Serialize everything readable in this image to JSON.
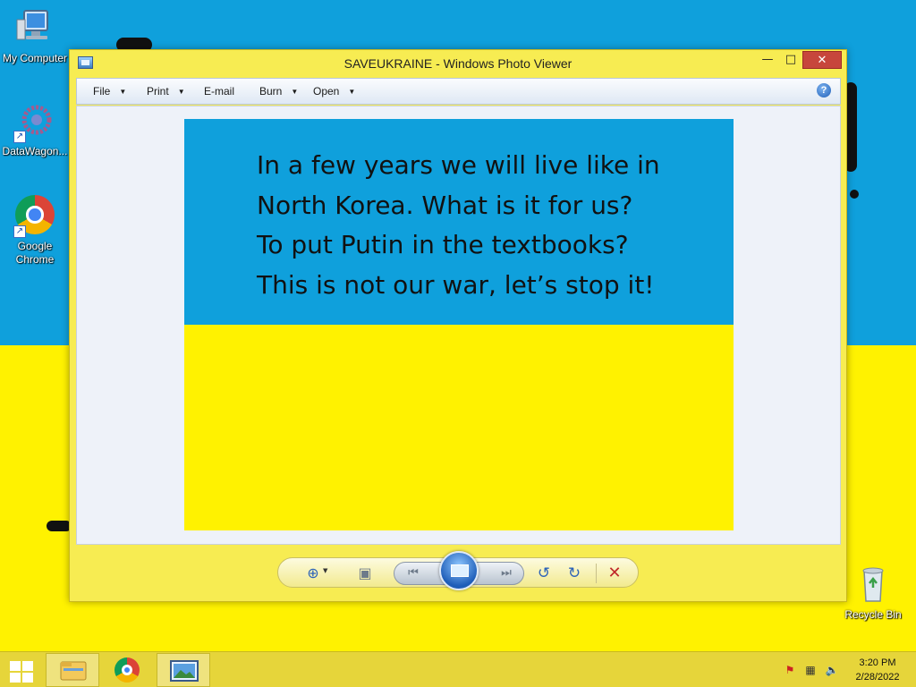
{
  "desktop": {
    "icons": [
      {
        "label": "My Computer",
        "icon": "computer-icon"
      },
      {
        "label": "DataWagon...",
        "icon": "datawagon-icon"
      },
      {
        "label": "Google Chrome",
        "icon": "chrome-icon"
      },
      {
        "label": "Recycle Bin",
        "icon": "recycle-bin-icon"
      }
    ],
    "wallpaper_colors": {
      "top": "#0fa0dc",
      "bottom": "#fff200"
    }
  },
  "window": {
    "title": "SAVEUKRAINE - Windows Photo Viewer",
    "buttons": {
      "minimize": "—",
      "maximize": "□",
      "close": "✕"
    },
    "menu": [
      {
        "label": "File",
        "has_dropdown": true
      },
      {
        "label": "Print",
        "has_dropdown": true
      },
      {
        "label": "E-mail",
        "has_dropdown": false
      },
      {
        "label": "Burn",
        "has_dropdown": true
      },
      {
        "label": "Open",
        "has_dropdown": true
      }
    ],
    "help": "?",
    "photo": {
      "colors": {
        "top": "#0fa0dc",
        "bottom": "#fff200"
      },
      "lines": [
        "In a few years we will live like in",
        "North Korea. What is it for us?",
        "To put Putin in the textbooks?",
        "This is not our war, let’s stop it!"
      ]
    },
    "controls": {
      "zoom": "⊕",
      "zoom_arrow": "▼",
      "actual_size": "▣",
      "previous": "⏮",
      "next": "⏭",
      "rotate_left": "↺",
      "rotate_right": "↻",
      "delete": "✕"
    }
  },
  "taskbar": {
    "items": [
      "file-explorer-icon",
      "chrome-icon",
      "photo-viewer-icon"
    ],
    "tray": {
      "flag": "⚑",
      "network": "▦",
      "volume": "🔈"
    },
    "clock": {
      "time": "3:20 PM",
      "date": "2/28/2022"
    }
  }
}
